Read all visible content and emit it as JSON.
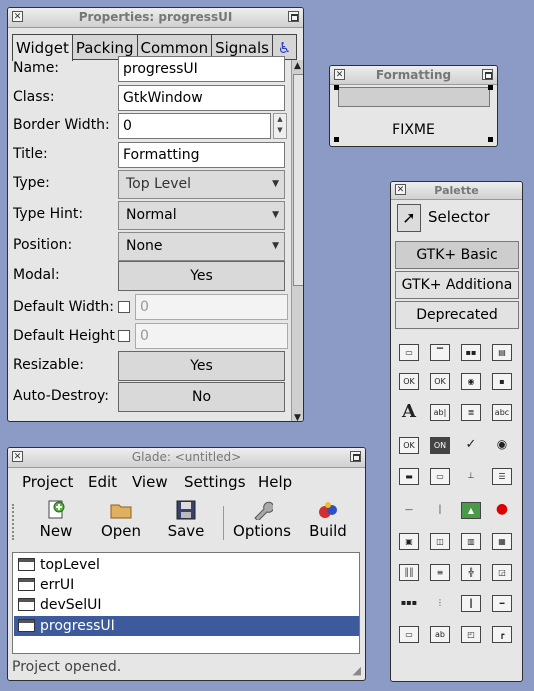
{
  "properties": {
    "title": "Properties: progressUI",
    "tabs": [
      "Widget",
      "Packing",
      "Common",
      "Signals"
    ],
    "rows": {
      "name": {
        "label": "Name:",
        "value": "progressUI"
      },
      "class": {
        "label": "Class:",
        "value": "GtkWindow"
      },
      "border_width": {
        "label": "Border Width:",
        "value": "0"
      },
      "title": {
        "label": "Title:",
        "value": "Formatting"
      },
      "type": {
        "label": "Type:",
        "value": "Top Level"
      },
      "type_hint": {
        "label": "Type Hint:",
        "value": "Normal"
      },
      "position": {
        "label": "Position:",
        "value": "None"
      },
      "modal": {
        "label": "Modal:",
        "value": "Yes"
      },
      "default_width": {
        "label": "Default Width:",
        "value": "0"
      },
      "default_height": {
        "label": "Default Height:",
        "value": "0"
      },
      "resizable": {
        "label": "Resizable:",
        "value": "Yes"
      },
      "auto_destroy": {
        "label": "Auto-Destroy:",
        "value": "No"
      }
    }
  },
  "formatting": {
    "title": "Formatting",
    "text": "FIXME"
  },
  "palette": {
    "title": "Palette",
    "selector_label": "Selector",
    "groups": [
      "GTK+ Basic",
      "GTK+ Additiona",
      "Deprecated"
    ]
  },
  "glade": {
    "title": "Glade: <untitled>",
    "menu": [
      "Project",
      "Edit",
      "View",
      "Settings",
      "Help"
    ],
    "toolbar": [
      "New",
      "Open",
      "Save",
      "Options",
      "Build"
    ],
    "tree": [
      "topLevel",
      "errUI",
      "devSelUI",
      "progressUI"
    ],
    "status": "Project opened."
  }
}
